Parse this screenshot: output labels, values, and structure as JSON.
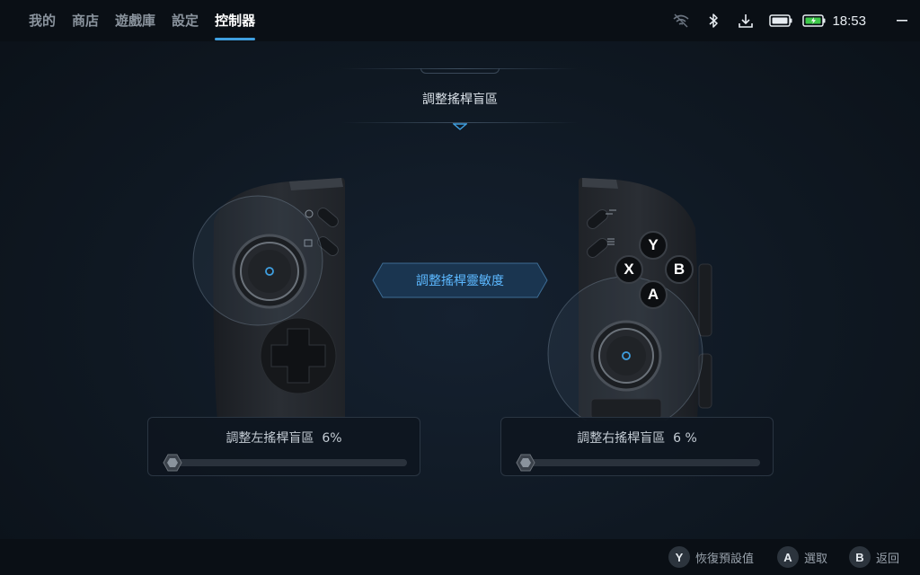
{
  "tabs": [
    {
      "label": "我的"
    },
    {
      "label": "商店"
    },
    {
      "label": "遊戲庫"
    },
    {
      "label": "設定"
    },
    {
      "label": "控制器"
    }
  ],
  "status": {
    "time": "18:53",
    "icons": [
      "wifi-off-icon",
      "bluetooth-icon",
      "download-icon",
      "controller-battery-icon",
      "battery-charging-icon",
      "minimize-icon"
    ]
  },
  "header": {
    "title": "調整搖桿盲區"
  },
  "center_button": {
    "label": "調整搖桿靈敏度"
  },
  "left_panel": {
    "label": "調整左搖桿盲區",
    "value_text": "6%",
    "value": 0.06
  },
  "right_panel": {
    "label": "調整右搖桿盲區",
    "value_text": "6 %",
    "value": 0.06
  },
  "face_buttons": {
    "y": "Y",
    "x": "X",
    "b": "B",
    "a": "A"
  },
  "bottom_hints": [
    {
      "key": "Y",
      "label": "恢復預設值"
    },
    {
      "key": "A",
      "label": "選取"
    },
    {
      "key": "B",
      "label": "返回"
    }
  ],
  "colors": {
    "accent": "#3f9fe0",
    "center_button_text": "#5cb8ff"
  }
}
